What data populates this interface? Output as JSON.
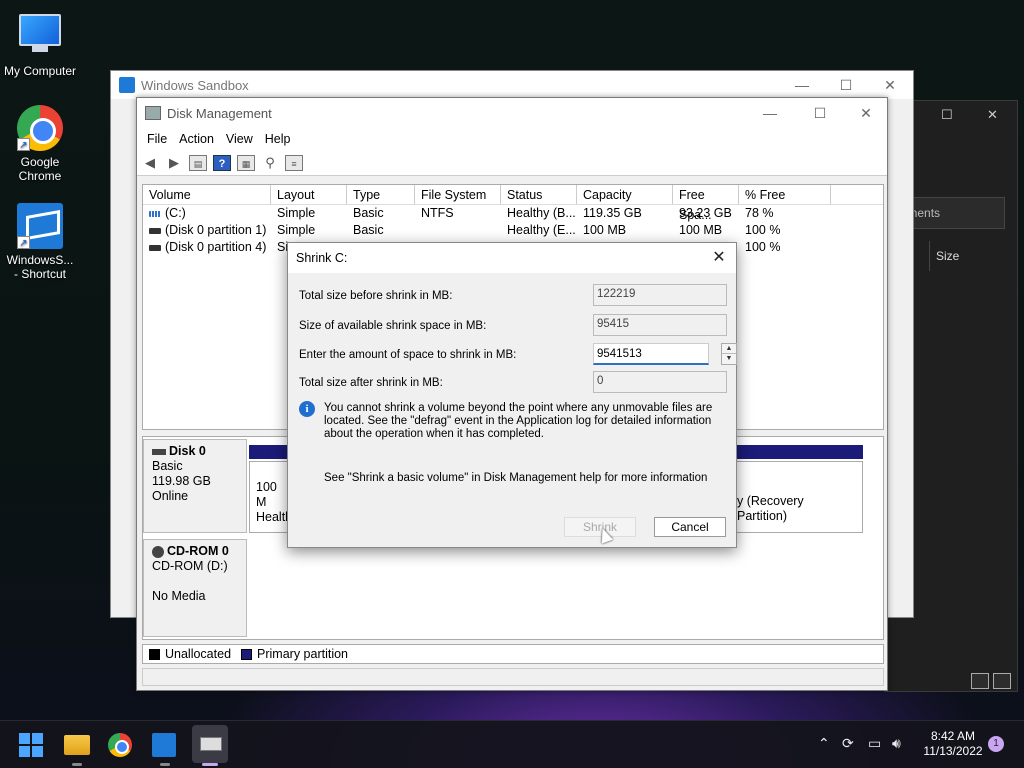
{
  "desktop": {
    "icons": [
      {
        "label": "My Computer"
      },
      {
        "label": "Google Chrome"
      },
      {
        "label": "WindowsS... - Shortcut"
      }
    ]
  },
  "background_window": {
    "search_text": "ocuments",
    "column_header": "Size"
  },
  "sandbox": {
    "title": "Windows Sandbox"
  },
  "disk_management": {
    "title": "Disk Management",
    "menu": [
      "File",
      "Action",
      "View",
      "Help"
    ],
    "columns": [
      "Volume",
      "Layout",
      "Type",
      "File System",
      "Status",
      "Capacity",
      "Free Spa...",
      "% Free"
    ],
    "volumes": [
      {
        "volume": "(C:)",
        "layout": "Simple",
        "type": "Basic",
        "fs": "NTFS",
        "status": "Healthy (B...",
        "capacity": "119.35 GB",
        "free": "93.23 GB",
        "pct": "78 %"
      },
      {
        "volume": "(Disk 0 partition 1)",
        "layout": "Simple",
        "type": "Basic",
        "fs": "",
        "status": "Healthy (E...",
        "capacity": "100 MB",
        "free": "100 MB",
        "pct": "100 %"
      },
      {
        "volume": "(Disk 0 partition 4)",
        "layout": "Si",
        "type": "",
        "fs": "",
        "status": "",
        "capacity": "",
        "free": "",
        "pct": "100 %"
      }
    ],
    "disks": [
      {
        "name": "Disk 0",
        "type": "Basic",
        "size": "119.98 GB",
        "state": "Online"
      },
      {
        "name": "CD-ROM 0",
        "type": "CD-ROM (D:)",
        "size": "",
        "state": "No Media"
      }
    ],
    "partition_left": {
      "line1": "100 M",
      "line2": "Health"
    },
    "partition_right": {
      "line1": "y (Recovery Partition)"
    },
    "legend": [
      "Unallocated",
      "Primary partition"
    ],
    "colors": {
      "unallocated": "#000000",
      "primary": "#1b1b7a"
    }
  },
  "shrink_dialog": {
    "title": "Shrink C:",
    "rows": [
      {
        "label": "Total size before shrink in MB:",
        "value": "122219"
      },
      {
        "label": "Size of available shrink space in MB:",
        "value": "95415"
      },
      {
        "label": "Enter the amount of space to shrink in MB:",
        "value": "9541513"
      },
      {
        "label": "Total size after shrink in MB:",
        "value": "0"
      }
    ],
    "info_text": "You cannot shrink a volume beyond the point where any unmovable files are located. See the \"defrag\" event in the Application log for detailed information about the operation when it has completed.",
    "help_text": "See \"Shrink a basic volume\" in Disk Management help for more information",
    "shrink_label": "Shrink",
    "cancel_label": "Cancel"
  },
  "taskbar": {
    "time": "8:42 AM",
    "date": "11/13/2022",
    "notification_count": "1"
  }
}
